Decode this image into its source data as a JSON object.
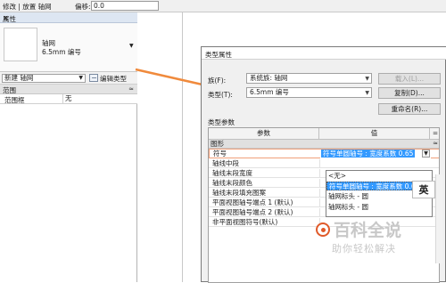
{
  "option_bar": {
    "context": "修改 | 放置 轴网",
    "offset_label": "偏移:",
    "offset_value": "0.0"
  },
  "properties": {
    "title": "属性",
    "close_glyph": "✕",
    "preview_name": "轴网",
    "preview_type": "6.5mm 编号",
    "new_selector": "新建 轴网",
    "edit_type_label": "编辑类型",
    "section": "范围",
    "rows": [
      {
        "label": "范围框",
        "value": "无"
      }
    ]
  },
  "dialog": {
    "title": "类型属性",
    "family_label": "族(F):",
    "family_value": "系统族: 轴网",
    "type_label": "类型(T):",
    "type_value": "6.5mm 编号",
    "load_button": "载入(L)...",
    "duplicate_button": "复制(D)...",
    "rename_button": "重命名(R)...",
    "type_params_label": "类型参数",
    "col_param": "参数",
    "col_value": "值",
    "col_eq": "=",
    "group": "图形",
    "symbol_label": "符号",
    "symbol_value": "符号单圆轴号 : 宽度系数 0.65",
    "params": [
      "轴线中段",
      "轴线末段宽度",
      "轴线末段颜色",
      "轴线末段填充图案",
      "平面视图轴号端点 1 (默认)",
      "平面视图轴号端点 2 (默认)",
      "非平面视图符号(默认)"
    ],
    "dropdown_options": [
      "<无>",
      "符号单圆轴号 : 宽度系数 0.65",
      "轴网标头 - 圆",
      "轴网标头 - 圆"
    ],
    "ime_label": "英"
  },
  "watermark": {
    "main": "百科全说",
    "sub": "助你轻松解决"
  },
  "colors": {
    "accent_arrow": "#f08a3c",
    "selection": "#3399ff"
  }
}
